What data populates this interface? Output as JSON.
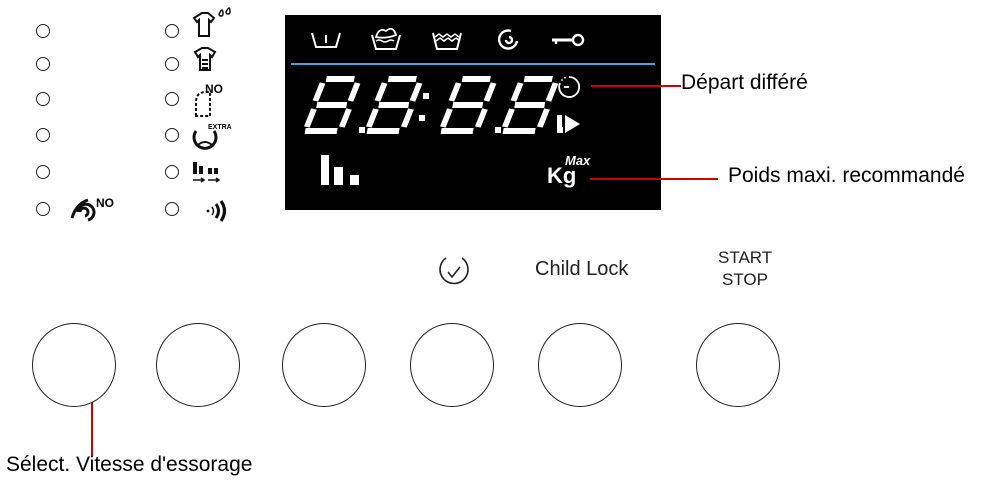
{
  "display": {
    "digits": "8.8:8.8.",
    "weight_unit": "Kg",
    "weight_max": "Max"
  },
  "icons": {
    "left_column": [
      "no-spin-icon"
    ],
    "right_column": [
      "shirt-drops-icon",
      "shirt-icon",
      "no-iron-icon",
      "extra-rinse-icon",
      "bars-arrows-icon",
      "sound-icon"
    ],
    "display_top": [
      "prewash-icon",
      "wash-icon",
      "rinse-icon",
      "spin-icon",
      "key-icon"
    ],
    "display_right": [
      "timer-icon",
      "play-icon"
    ]
  },
  "labels": {
    "extra": "EXTRA",
    "no": "NO"
  },
  "buttons": {
    "delay_icon": "clock-icon",
    "child_lock": "Child Lock",
    "start_line1": "START",
    "start_line2": "STOP"
  },
  "callouts": {
    "delayed_start": "Départ différé",
    "max_weight": "Poids maxi. recommandé",
    "spin_speed": "Sélect. Vitesse d'essorage"
  },
  "colors": {
    "display_bg": "#000000",
    "display_fg": "#ffffff",
    "separator": "#4aa3d8",
    "callout_line": "#cc0000"
  }
}
